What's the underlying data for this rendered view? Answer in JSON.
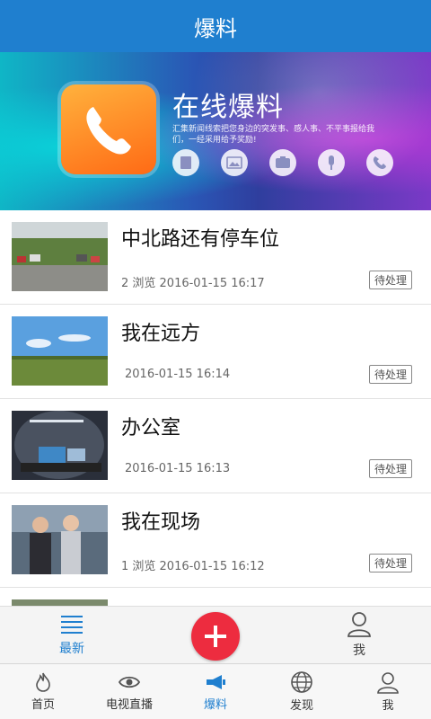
{
  "header": {
    "title": "爆料"
  },
  "banner": {
    "title": "在线爆料",
    "desc": "汇集新闻线索把您身边的突发事、感人事、不平事报给我们，一经采用给予奖励!"
  },
  "list": [
    {
      "title": "中北路还有停车位",
      "meta": "2 浏览  2016-01-15 16:17",
      "badge": "待处理"
    },
    {
      "title": "我在远方",
      "meta": "2016-01-15 16:14",
      "badge": "待处理"
    },
    {
      "title": "办公室",
      "meta": "2016-01-15 16:13",
      "badge": "待处理"
    },
    {
      "title": "我在现场",
      "meta": "1 浏览  2016-01-15 16:12",
      "badge": "待处理"
    },
    {
      "title": "",
      "meta": "",
      "badge": ""
    }
  ],
  "subtabs": {
    "latest": "最新",
    "me": "我"
  },
  "nav": [
    {
      "label": "首页",
      "icon": "flame-icon"
    },
    {
      "label": "电视直播",
      "icon": "eye-icon"
    },
    {
      "label": "爆料",
      "icon": "megaphone-icon"
    },
    {
      "label": "发现",
      "icon": "globe-icon"
    },
    {
      "label": "我",
      "icon": "user-icon"
    }
  ],
  "colors": {
    "primary": "#1f7fcf",
    "accent": "#ed2c3f"
  }
}
